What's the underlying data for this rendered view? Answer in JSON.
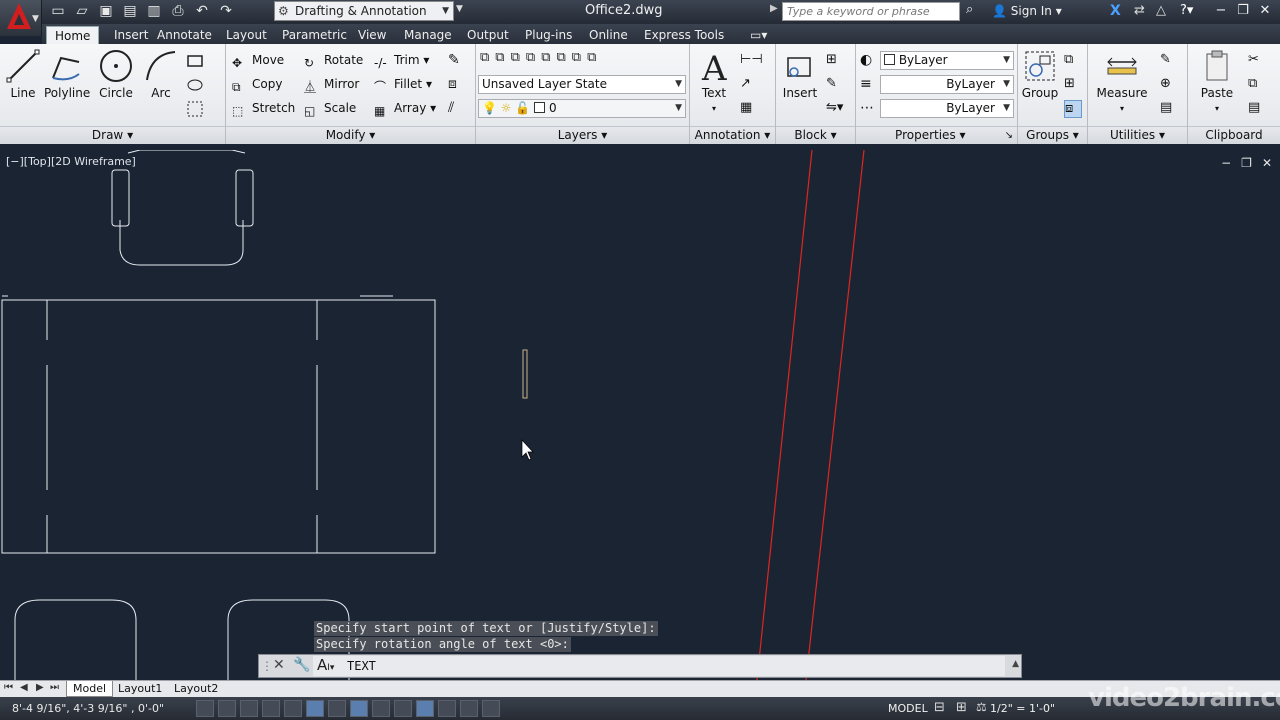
{
  "titlebar": {
    "workspace": "Drafting & Annotation",
    "document_title": "Office2.dwg",
    "search_placeholder": "Type a keyword or phrase",
    "sign_in": "Sign In"
  },
  "tabs": [
    "Home",
    "Insert",
    "Annotate",
    "Layout",
    "Parametric",
    "View",
    "Manage",
    "Output",
    "Plug-ins",
    "Online",
    "Express Tools"
  ],
  "ribbon": {
    "draw": {
      "title": "Draw",
      "line": "Line",
      "polyline": "Polyline",
      "circle": "Circle",
      "arc": "Arc"
    },
    "modify": {
      "title": "Modify",
      "move": "Move",
      "rotate": "Rotate",
      "trim": "Trim",
      "copy": "Copy",
      "mirror": "Mirror",
      "fillet": "Fillet",
      "stretch": "Stretch",
      "scale": "Scale",
      "array": "Array"
    },
    "layers": {
      "title": "Layers",
      "layer_state": "Unsaved Layer State",
      "current_layer": "0"
    },
    "annotation": {
      "title": "Annotation",
      "text": "Text"
    },
    "block": {
      "title": "Block",
      "insert": "Insert"
    },
    "properties": {
      "title": "Properties",
      "color": "ByLayer",
      "linetype": "ByLayer",
      "lineweight": "ByLayer"
    },
    "groups": {
      "title": "Groups",
      "group": "Group"
    },
    "utilities": {
      "title": "Utilities",
      "measure": "Measure"
    },
    "clipboard": {
      "title": "Clipboard",
      "paste": "Paste"
    }
  },
  "viewport": {
    "label": "[−][Top][2D Wireframe]"
  },
  "command": {
    "history": [
      "Specify start point of text or [Justify/Style]:",
      "Specify rotation angle of text <0>:"
    ],
    "current": "TEXT"
  },
  "layout_tabs": [
    "Model",
    "Layout1",
    "Layout2"
  ],
  "statusbar": {
    "coordinates": "8'-4 9/16\",  4'-3 9/16\" , 0'-0\"",
    "model": "MODEL",
    "scale": "1/2\" = 1'-0\""
  },
  "watermark": "video2brain.com",
  "colors": {
    "canvas": "#1b2433",
    "red_line": "#e0261e",
    "accent": "#5a7fae"
  }
}
